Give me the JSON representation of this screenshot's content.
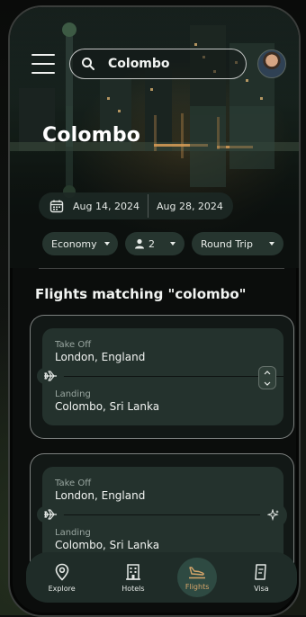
{
  "search": {
    "value": "Colombo"
  },
  "destination": {
    "title": "Colombo"
  },
  "dates": {
    "depart": "Aug 14, 2024",
    "return": "Aug 28, 2024"
  },
  "filters": {
    "cabin": "Economy",
    "passengers": "2",
    "trip_type": "Round Trip"
  },
  "results": {
    "heading": "Flights matching \"colombo\"",
    "flights": [
      {
        "takeoff_label": "Take Off",
        "takeoff_city": "London, England",
        "landing_label": "Landing",
        "landing_city": "Colombo, Sri Lanka"
      },
      {
        "takeoff_label": "Take Off",
        "takeoff_city": "London, England",
        "landing_label": "Landing",
        "landing_city": "Colombo, Sri Lanka"
      }
    ]
  },
  "nav": {
    "items": [
      {
        "label": "Explore",
        "icon": "map-pin-icon"
      },
      {
        "label": "Hotels",
        "icon": "hotel-icon"
      },
      {
        "label": "Flights",
        "icon": "plane-landing-icon",
        "active": true
      },
      {
        "label": "Visa",
        "icon": "passport-icon"
      }
    ]
  },
  "colors": {
    "accent": "#d8a66a",
    "card": "#24322d",
    "background": "#0b0d0c"
  }
}
